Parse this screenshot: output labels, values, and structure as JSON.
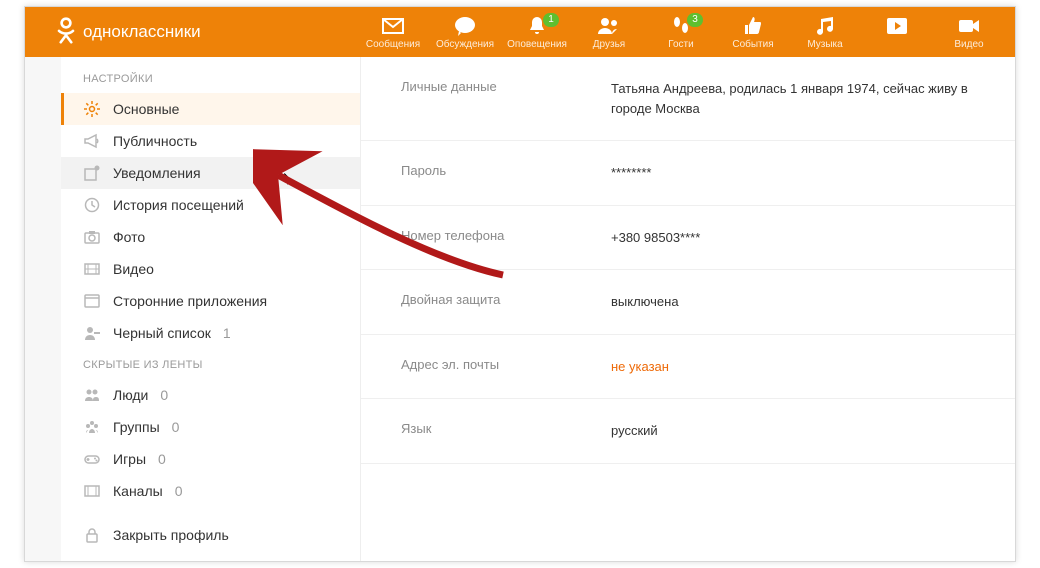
{
  "brand": "одноклассники",
  "nav": {
    "messages": "Сообщения",
    "discussions": "Обсуждения",
    "notifications": "Оповещения",
    "notifications_badge": "1",
    "friends": "Друзья",
    "guests": "Гости",
    "guests_badge": "3",
    "events": "События",
    "music": "Музыка",
    "video": "Видео"
  },
  "sidebar": {
    "section1_title": "НАСТРОЙКИ",
    "main_label": "Основные",
    "publicity_label": "Публичность",
    "notifications_label": "Уведомления",
    "history_label": "История посещений",
    "photo_label": "Фото",
    "video_label": "Видео",
    "apps_label": "Сторонние приложения",
    "blacklist_label": "Черный список",
    "blacklist_count": "1",
    "section2_title": "СКРЫТЫЕ ИЗ ЛЕНТЫ",
    "people_label": "Люди",
    "people_count": "0",
    "groups_label": "Группы",
    "groups_count": "0",
    "games_label": "Игры",
    "games_count": "0",
    "channels_label": "Каналы",
    "channels_count": "0",
    "close_profile_label": "Закрыть профиль"
  },
  "settings": {
    "personal_label": "Личные данные",
    "personal_value": "Татьяна Андреева, родилась 1 января 1974, сейчас живу в городе Москва",
    "password_label": "Пароль",
    "password_value": "********",
    "phone_label": "Номер телефона",
    "phone_value": "+380 98503****",
    "double_protection_label": "Двойная защита",
    "double_protection_value": "выключена",
    "email_label": "Адрес эл. почты",
    "email_value": "не указан",
    "language_label": "Язык",
    "language_value": "русский"
  }
}
